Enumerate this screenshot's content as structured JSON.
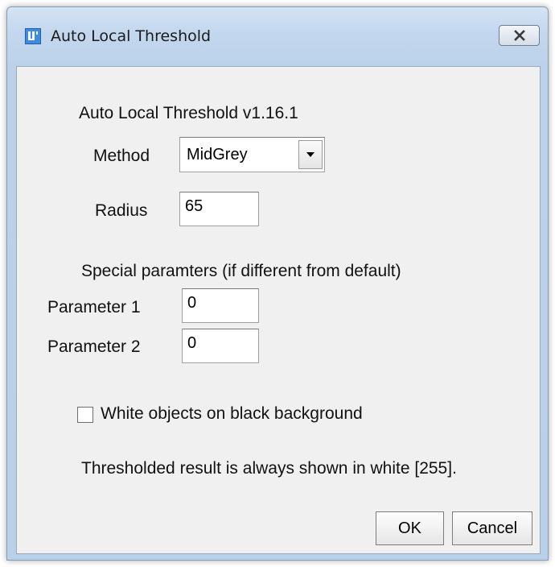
{
  "window": {
    "title": "Auto Local Threshold"
  },
  "dialog": {
    "header": "Auto Local Threshold v1.16.1",
    "method": {
      "label": "Method",
      "value": "MidGrey"
    },
    "radius": {
      "label": "Radius",
      "value": "65"
    },
    "special_header": "Special paramters (if different from default)",
    "parameter1": {
      "label": "Parameter 1",
      "value": "0"
    },
    "parameter2": {
      "label": "Parameter 2",
      "value": "0"
    },
    "white_objects": {
      "label": "White objects on black background",
      "checked": false
    },
    "note": "Thresholded result is always shown in white [255].",
    "ok_label": "OK",
    "cancel_label": "Cancel"
  },
  "icons": {
    "app": "imagej-icon",
    "close": "close-icon",
    "dropdown": "chevron-down-icon"
  },
  "colors": {
    "titlebar": "#c3d7ee",
    "client_background": "#f0f0f0",
    "app_icon": "#3e8be6"
  }
}
